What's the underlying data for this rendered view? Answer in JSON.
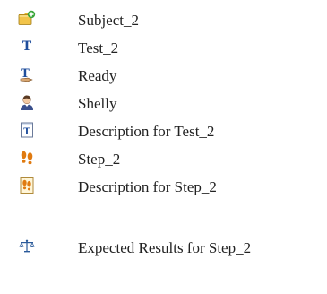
{
  "items": [
    {
      "label": "Subject_2",
      "icon": "folder-add-icon"
    },
    {
      "label": "Test_2",
      "icon": "test-t-icon"
    },
    {
      "label": "Ready",
      "icon": "test-status-icon"
    },
    {
      "label": "Shelly",
      "icon": "user-icon"
    },
    {
      "label": "Description for Test_2",
      "icon": "document-t-icon"
    },
    {
      "label": "Step_2",
      "icon": "footsteps-icon"
    },
    {
      "label": "Description for Step_2",
      "icon": "document-footsteps-icon"
    },
    {
      "label": "Expected Results for Step_2",
      "icon": "scales-icon"
    }
  ],
  "colors": {
    "text": "#222222",
    "folder": "#d4a017",
    "plus": "#3aa63a",
    "test_blue": "#1f4e9c",
    "step_orange": "#e07a10"
  }
}
